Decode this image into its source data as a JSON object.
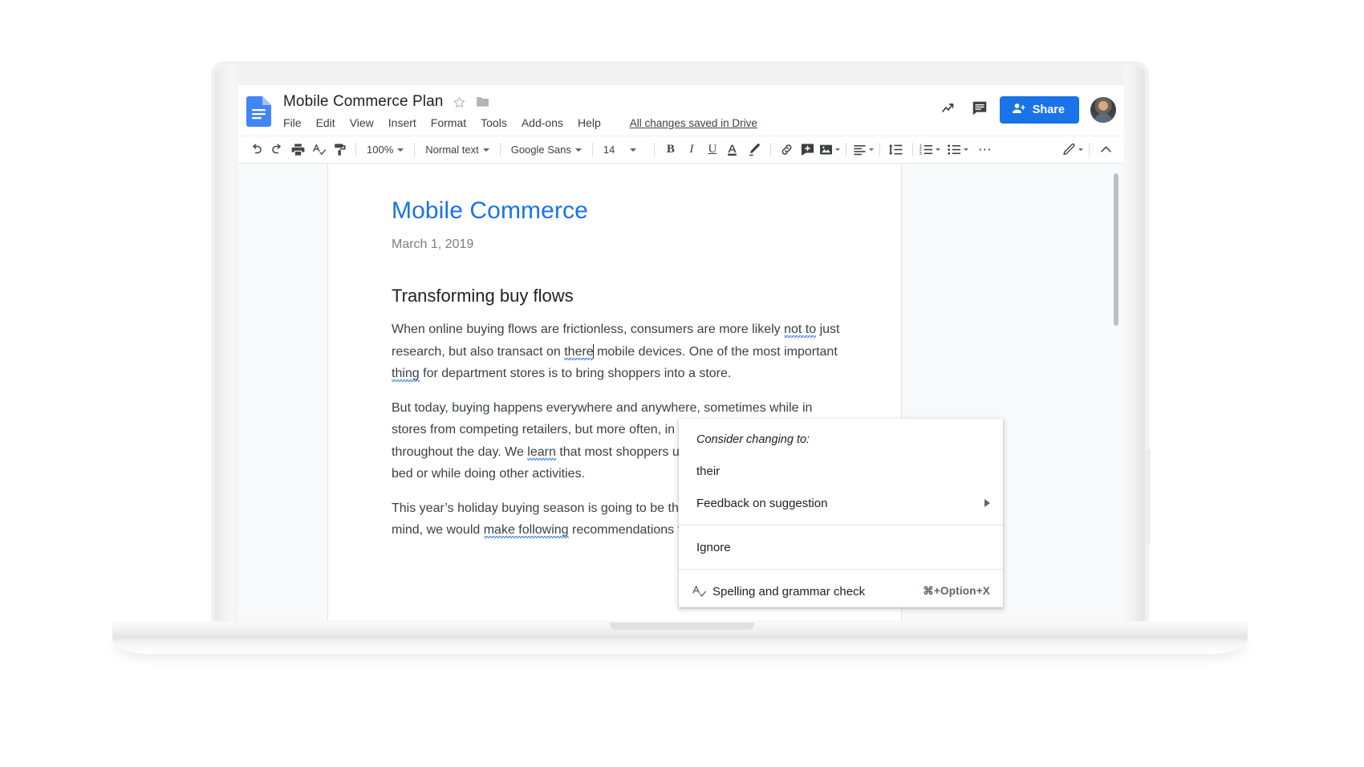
{
  "app": {
    "doc_title": "Mobile Commerce Plan",
    "save_status": "All changes saved in Drive",
    "star_icon": "star-outline-icon",
    "folder_icon": "folder-icon",
    "logo_icon": "google-docs-logo-icon"
  },
  "menubar": {
    "items": [
      {
        "label": "File"
      },
      {
        "label": "Edit"
      },
      {
        "label": "View"
      },
      {
        "label": "Insert"
      },
      {
        "label": "Format"
      },
      {
        "label": "Tools"
      },
      {
        "label": "Add-ons"
      },
      {
        "label": "Help"
      }
    ]
  },
  "header_actions": {
    "activity_icon": "trending-up-icon",
    "comments_icon": "comment-icon",
    "share_label": "Share",
    "share_icon": "person-add-icon",
    "share_color": "#1a73e8",
    "avatar_icon": "user-avatar"
  },
  "toolbar": {
    "undo_icon": "undo-icon",
    "redo_icon": "redo-icon",
    "print_icon": "print-icon",
    "spellcheck_icon": "spellcheck-icon",
    "paint_format_icon": "paint-format-icon",
    "zoom_value": "100%",
    "style_value": "Normal text",
    "font_value": "Google Sans",
    "font_size_value": "14",
    "bold_label": "B",
    "italic_label": "I",
    "underline_label": "U",
    "text_color_icon": "text-color-icon",
    "highlight_icon": "highlight-pen-icon",
    "link_icon": "insert-link-icon",
    "comment_icon": "add-comment-icon",
    "image_icon": "insert-image-icon",
    "align_icon": "align-left-icon",
    "line_spacing_icon": "line-spacing-icon",
    "numbered_list_icon": "numbered-list-icon",
    "bulleted_list_icon": "bulleted-list-icon",
    "more_icon": "more-horizontal-icon",
    "editing_mode_icon": "pencil-edit-icon",
    "collapse_icon": "chevron-up-icon"
  },
  "document": {
    "heading1": "Mobile Commerce",
    "date": "March 1, 2019",
    "heading2": "Transforming buy flows",
    "p1_a": "When online buying flows are frictionless, consumers are more likely ",
    "p1_err1": "not to",
    "p1_b": " just research, but also transact on ",
    "p1_err2": "there",
    "p1_c": " mobile devices. One of the most important ",
    "p1_err3": "thing",
    "p1_d": " for department stores is to bring shoppers into a store.",
    "p2_a": "But today, buying happens everywhere and anywhere, sometimes while in stores from competing retailers, but more often, in numerous micro-moments throughout the day. We ",
    "p2_err1": "learn",
    "p2_b": " that most shoppers use their mobile devices in bed or while doing other activities.",
    "p3_a": "This year’s holiday buying season is going to be the biggest ever. With this in mind, we would ",
    "p3_err1": "make following",
    "p3_b": " recommendations for the holiday"
  },
  "context_menu": {
    "hint": "Consider changing to:",
    "suggestion": "their",
    "feedback_label": "Feedback on suggestion",
    "ignore_label": "Ignore",
    "spellcheck_label": "Spelling and grammar check",
    "spellcheck_shortcut": "⌘+Option+X",
    "spellcheck_icon": "spellcheck-icon",
    "submenu_arrow_icon": "triangle-right-icon"
  }
}
